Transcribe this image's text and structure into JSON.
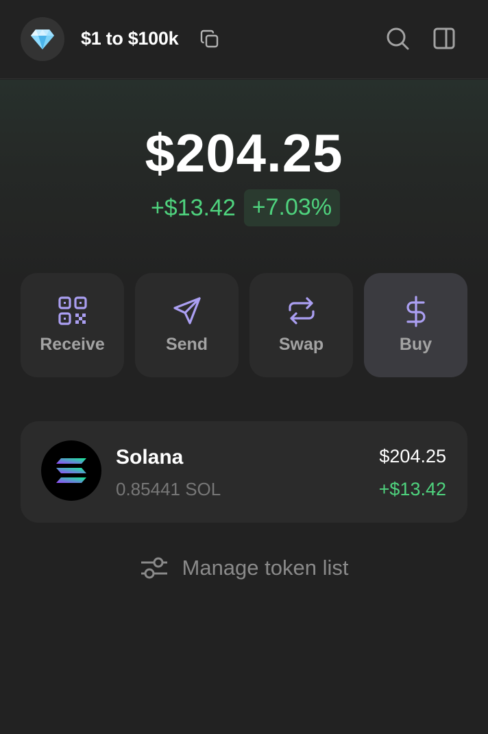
{
  "header": {
    "avatar_emoji": "💎",
    "account_name": "$1 to $100k",
    "icons": [
      "diamond-avatar-icon",
      "copy-icon",
      "search-icon",
      "sidebar-toggle-icon"
    ]
  },
  "balance": {
    "total": "$204.25",
    "change_amount": "+$13.42",
    "change_percent": "+7.03%"
  },
  "actions": [
    {
      "label": "Receive",
      "icon": "qr-code-icon"
    },
    {
      "label": "Send",
      "icon": "send-icon"
    },
    {
      "label": "Swap",
      "icon": "swap-icon"
    },
    {
      "label": "Buy",
      "icon": "dollar-icon"
    }
  ],
  "tokens": [
    {
      "name": "Solana",
      "amount": "0.85441 SOL",
      "value": "$204.25",
      "change": "+$13.42",
      "icon": "solana-logo"
    }
  ],
  "manage": {
    "label": "Manage token list",
    "icon": "sliders-icon"
  },
  "colors": {
    "background": "#222222",
    "card": "#2b2b2b",
    "accent_purple": "#ab9ff2",
    "positive_green": "#4fd37e",
    "muted_text": "#a3a3a3"
  }
}
